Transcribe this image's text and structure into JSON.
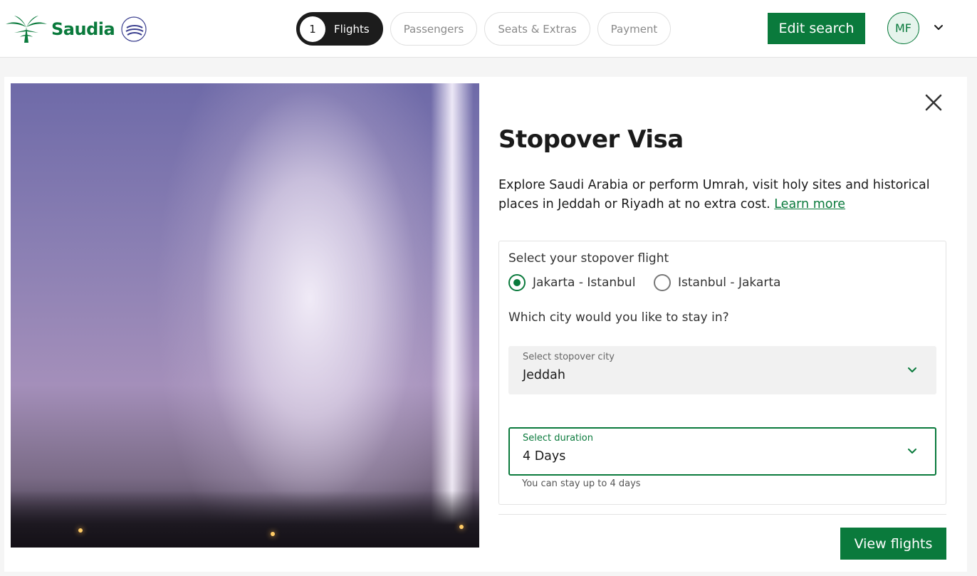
{
  "brand": {
    "name": "Saudia",
    "primary_color": "#0a7a3c",
    "partner_logo": "skyteam-logo"
  },
  "steps": [
    {
      "number": "1",
      "label": "Flights",
      "active": true
    },
    {
      "label": "Passengers",
      "active": false
    },
    {
      "label": "Seats & Extras",
      "active": false
    },
    {
      "label": "Payment",
      "active": false
    }
  ],
  "header": {
    "edit_search_label": "Edit search",
    "user_initials": "MF"
  },
  "modal": {
    "title": "Stopover Visa",
    "description": "Explore Saudi Arabia or perform Umrah, visit holy sites and historical places in Jeddah or Riyadh at no extra cost. ",
    "learn_more": "Learn more",
    "stopover_flight_label": "Select your stopover flight",
    "flight_options": [
      {
        "label": "Jakarta - Istanbul",
        "selected": true
      },
      {
        "label": "Istanbul - Jakarta",
        "selected": false
      }
    ],
    "city_question": "Which city would you like to stay in?",
    "city_select": {
      "label": "Select stopover city",
      "value": "Jeddah"
    },
    "duration_select": {
      "label": "Select duration",
      "value": "4 Days"
    },
    "duration_hint": "You can stay up to 4 days",
    "view_flights_label": "View flights"
  }
}
